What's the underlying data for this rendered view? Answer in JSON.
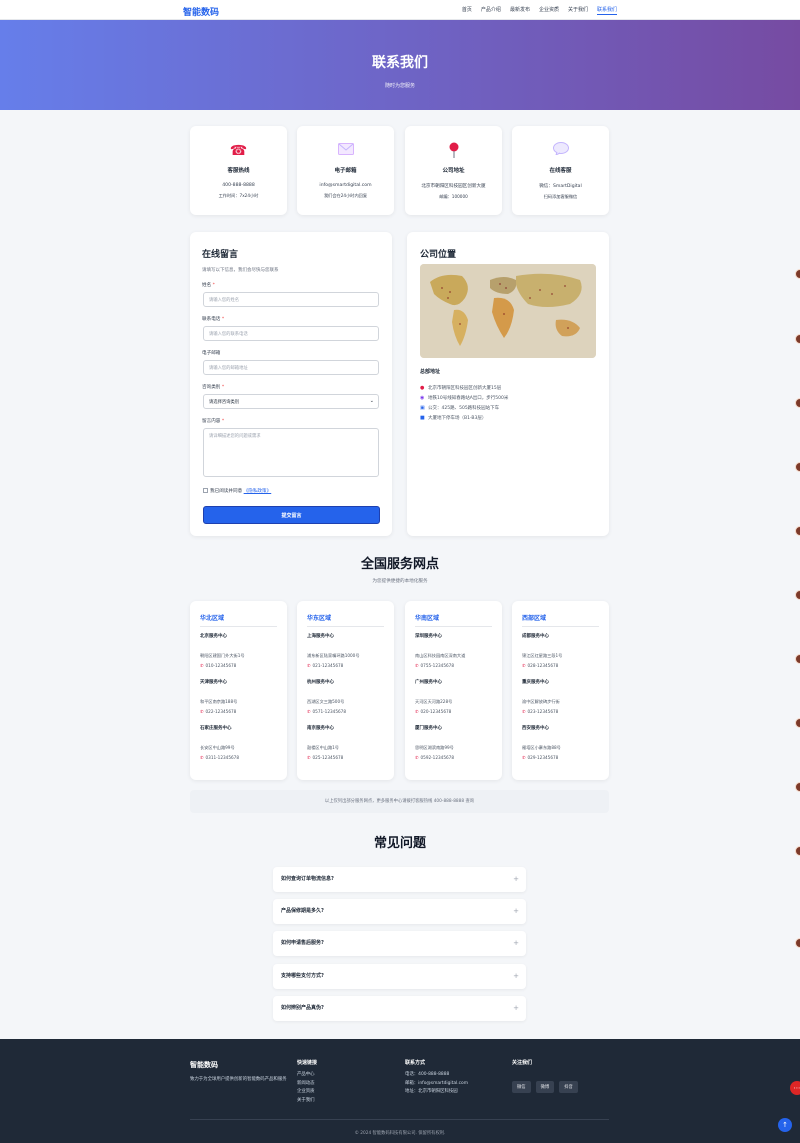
{
  "nav": {
    "logo": "智能数码",
    "links": [
      "首页",
      "产品介绍",
      "最新发布",
      "企业资质",
      "关于我们",
      "联系我们"
    ]
  },
  "hero": {
    "title": "联系我们",
    "subtitle": "随时为您服务"
  },
  "contact_cards": [
    {
      "icon": "phone-icon",
      "title": "客服热线",
      "line1": "400-888-8888",
      "line2": "工作时间：7x24小时"
    },
    {
      "icon": "mail-icon",
      "title": "电子邮箱",
      "line1": "info@smartdigital.com",
      "line2": "我们会在24小时内回复"
    },
    {
      "icon": "pin-icon",
      "title": "公司地址",
      "line1": "北京市朝阳区科技园区创新大厦",
      "line2": "邮编：100000"
    },
    {
      "icon": "chat-icon",
      "title": "在线客服",
      "line1": "微信：SmartDigital",
      "line2": "扫码添加客服微信"
    }
  ],
  "form": {
    "title": "在线留言",
    "subtitle": "请填写以下信息，我们会尽快与您联系",
    "name_label": "姓名",
    "name_placeholder": "请输入您的姓名",
    "phone_label": "联系电话",
    "phone_placeholder": "请输入您的联系电话",
    "email_label": "电子邮箱",
    "email_placeholder": "请输入您的邮箱地址",
    "type_label": "咨询类别",
    "type_value": "请选择咨询类别",
    "content_label": "留言内容",
    "content_placeholder": "请详细描述您的问题或需求",
    "agree_text": "我已阅读并同意",
    "privacy_link": "《隐私政策》",
    "submit": "提交留言"
  },
  "location": {
    "title": "公司位置",
    "hq_title": "总部地址",
    "lines": [
      {
        "icon": "pin-icon",
        "text": "北京市朝阳区科技园区创新大厦15层"
      },
      {
        "icon": "subway-icon",
        "text": "地铁10号线知春路站A出口，步行500米"
      },
      {
        "icon": "bus-icon",
        "text": "公交：425路、505路科技园站下车"
      },
      {
        "icon": "parking-icon",
        "text": "大厦地下停车场（B1-B3层）"
      }
    ]
  },
  "service": {
    "title": "全国服务网点",
    "subtitle": "为您提供便捷的本地化服务",
    "regions": [
      {
        "name": "华北区域",
        "centers": [
          {
            "name": "北京服务中心",
            "address": "朝阳区建国门外大街1号",
            "phone": "010-12345678"
          },
          {
            "name": "天津服务中心",
            "address": "和平区南京路188号",
            "phone": "022-12345678"
          },
          {
            "name": "石家庄服务中心",
            "address": "长安区中山路99号",
            "phone": "0311-12345678"
          }
        ]
      },
      {
        "name": "华东区域",
        "centers": [
          {
            "name": "上海服务中心",
            "address": "浦东新区陆家嘴环路1000号",
            "phone": "021-12345678"
          },
          {
            "name": "杭州服务中心",
            "address": "西湖区文三路500号",
            "phone": "0571-12345678"
          },
          {
            "name": "南京服务中心",
            "address": "鼓楼区中山路1号",
            "phone": "025-12345678"
          }
        ]
      },
      {
        "name": "华南区域",
        "centers": [
          {
            "name": "深圳服务中心",
            "address": "南山区科技园南区深南大道",
            "phone": "0755-12345678"
          },
          {
            "name": "广州服务中心",
            "address": "天河区天河路228号",
            "phone": "020-12345678"
          },
          {
            "name": "厦门服务中心",
            "address": "思明区湖滨南路99号",
            "phone": "0592-12345678"
          }
        ]
      },
      {
        "name": "西部区域",
        "centers": [
          {
            "name": "成都服务中心",
            "address": "锦江区红星路三段1号",
            "phone": "028-12345678"
          },
          {
            "name": "重庆服务中心",
            "address": "渝中区解放碑步行街",
            "phone": "023-12345678"
          },
          {
            "name": "西安服务中心",
            "address": "雁塔区小寨东路88号",
            "phone": "029-12345678"
          }
        ]
      }
    ],
    "note": "以上仅列出部分服务网点，更多服务中心请拨打客服热线 400-888-8888 查询"
  },
  "faq": {
    "title": "常见问题",
    "items": [
      "如何查询订单物流信息?",
      "产品保修期是多久?",
      "如何申请售后服务?",
      "支持哪些支付方式?",
      "如何辨别产品真伪?"
    ]
  },
  "footer": {
    "brand": "智能数码",
    "desc": "致力于为全球用户提供创新的智能数码产品和服务",
    "quick_title": "快速链接",
    "quick_links": [
      "产品中心",
      "新闻动态",
      "企业资质",
      "关于我们"
    ],
    "contact_title": "联系方式",
    "contact_lines": [
      "电话：400-888-8888",
      "邮箱：info@smartdigital.com",
      "地址：北京市朝阳区科技园"
    ],
    "follow_title": "关注我们",
    "social": [
      "微信",
      "微博",
      "抖音"
    ],
    "copyright": "© 2024 智能数码科技有限公司. 保留所有权利."
  }
}
